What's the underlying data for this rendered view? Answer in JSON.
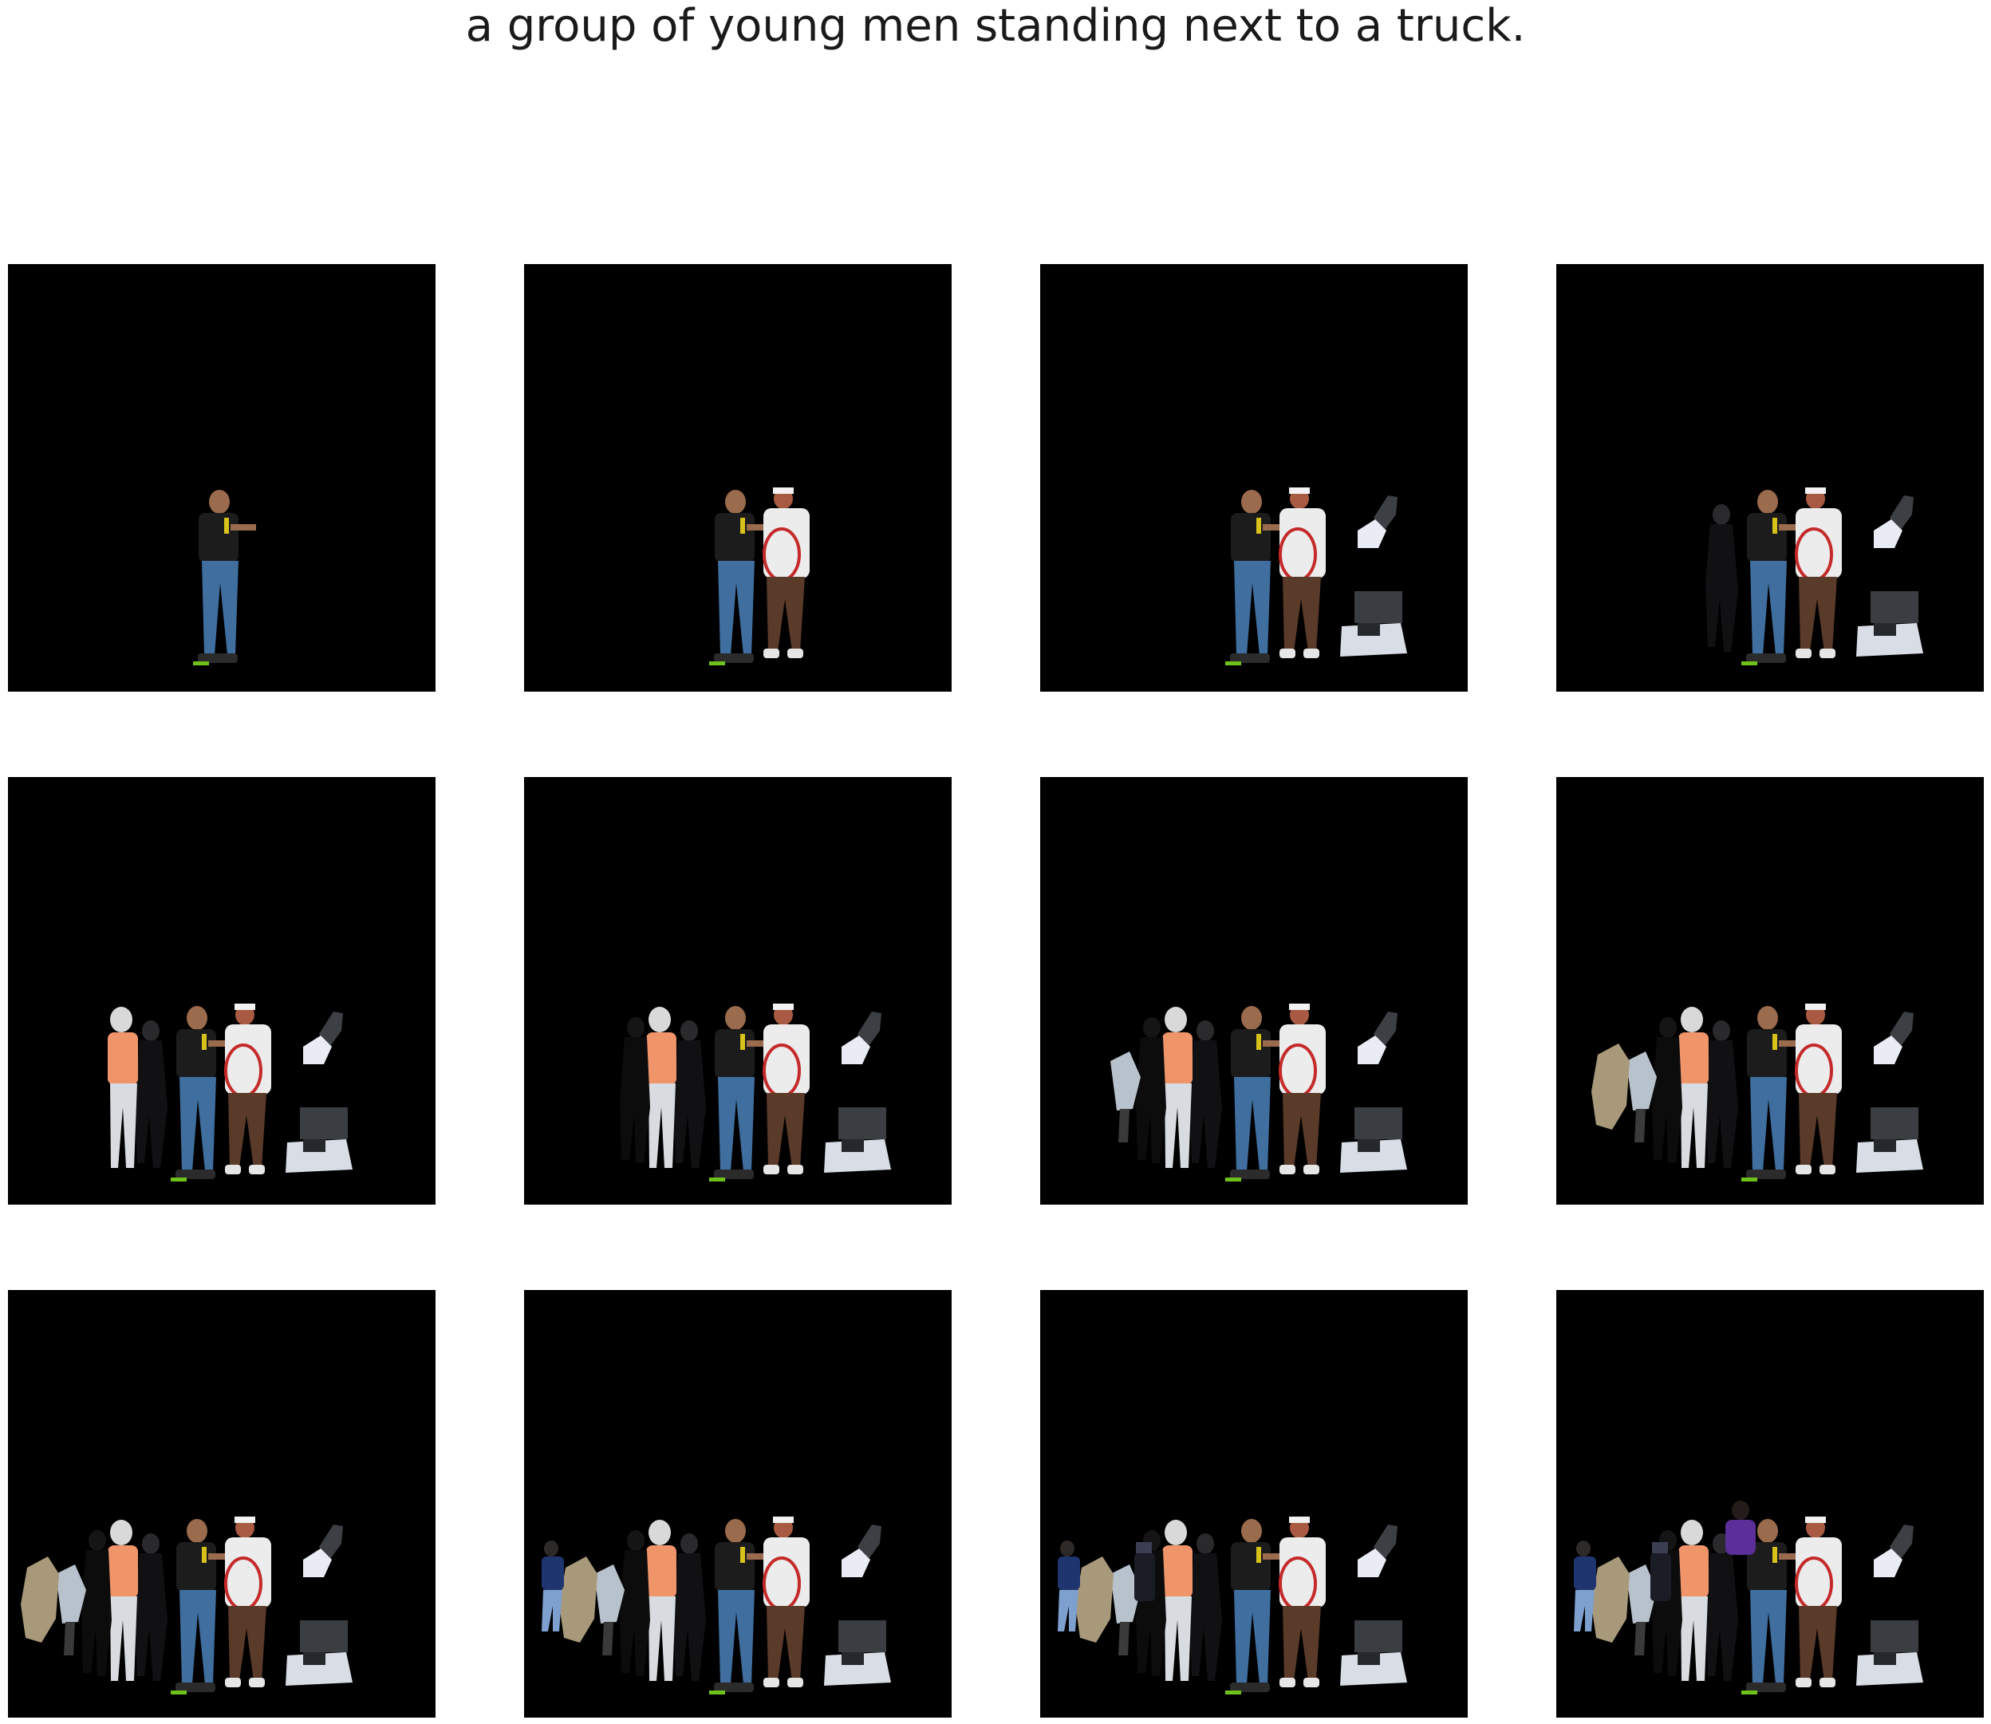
{
  "figure": {
    "title": "a group of young men standing next to a truck.",
    "background_color": "#000000",
    "rows": 3,
    "columns": 4,
    "panels": [
      {
        "objects": [
          "man-black-shirt"
        ]
      },
      {
        "objects": [
          "man-black-shirt",
          "man-white-shirt-cap"
        ]
      },
      {
        "objects": [
          "man-black-shirt",
          "man-white-shirt-cap",
          "glove",
          "truck-fragment"
        ]
      },
      {
        "objects": [
          "man-black-shirt",
          "man-white-shirt-cap",
          "glove",
          "truck-fragment",
          "dark-figure"
        ]
      },
      {
        "objects": [
          "man-black-shirt",
          "man-white-shirt-cap",
          "glove",
          "truck-fragment",
          "dark-figure",
          "man-orange-shirt"
        ]
      },
      {
        "objects": [
          "man-black-shirt",
          "man-white-shirt-cap",
          "glove",
          "truck-fragment",
          "dark-figure",
          "man-orange-shirt",
          "black-silhouette"
        ]
      },
      {
        "objects": [
          "man-black-shirt",
          "man-white-shirt-cap",
          "glove",
          "truck-fragment",
          "dark-figure",
          "man-orange-shirt",
          "black-silhouette",
          "grey-figure"
        ]
      },
      {
        "objects": [
          "man-black-shirt",
          "man-white-shirt-cap",
          "glove",
          "truck-fragment",
          "dark-figure",
          "man-orange-shirt",
          "black-silhouette",
          "grey-figure",
          "tan-blob"
        ]
      },
      {
        "objects": [
          "man-black-shirt",
          "man-white-shirt-cap",
          "glove",
          "truck-fragment",
          "dark-figure",
          "man-orange-shirt",
          "black-silhouette",
          "grey-figure",
          "tan-blob",
          "small-dark-person"
        ]
      },
      {
        "objects": [
          "man-black-shirt",
          "man-white-shirt-cap",
          "glove",
          "truck-fragment",
          "dark-figure",
          "man-orange-shirt",
          "black-silhouette",
          "grey-figure",
          "tan-blob",
          "blue-jacket-person"
        ]
      },
      {
        "objects": [
          "man-black-shirt",
          "man-white-shirt-cap",
          "glove",
          "truck-fragment",
          "dark-figure",
          "man-orange-shirt",
          "black-silhouette",
          "grey-figure",
          "tan-blob",
          "blue-jacket-person",
          "camera-person"
        ]
      },
      {
        "objects": [
          "man-black-shirt",
          "man-white-shirt-cap",
          "glove",
          "truck-fragment",
          "dark-figure",
          "man-orange-shirt",
          "black-silhouette",
          "grey-figure",
          "tan-blob",
          "blue-jacket-person",
          "camera-person",
          "purple-shirt-person"
        ]
      }
    ]
  }
}
